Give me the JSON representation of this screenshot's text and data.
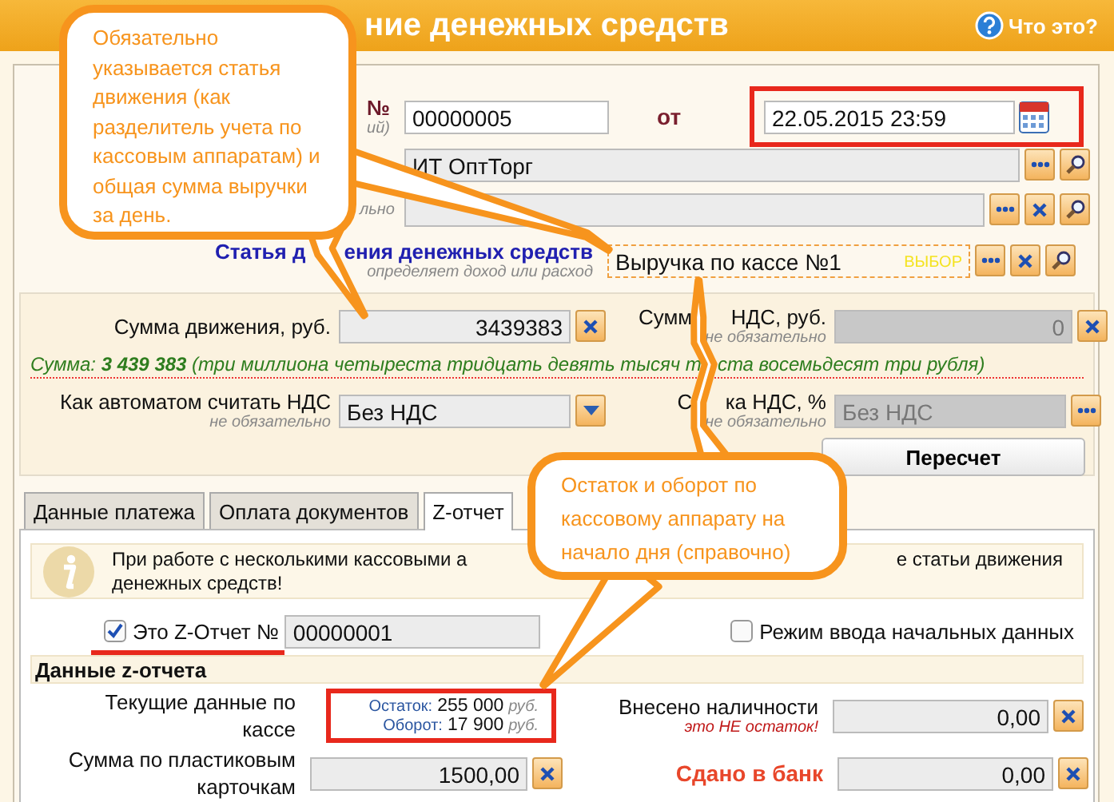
{
  "header": {
    "title": "ние денежных средств",
    "help_link": "Что это?"
  },
  "document": {
    "number_label": "№",
    "number_hint": "ий)",
    "number": "00000005",
    "date_label": "от",
    "date": "22.05.2015 23:59",
    "date_highlighted": true
  },
  "organization": {
    "value": "ИТ ОптТорг"
  },
  "row_3": {
    "hint": "льно"
  },
  "cash_flow_item": {
    "label_parts": [
      "Статья д",
      "ения денежных средств"
    ],
    "hint": "определяет доход или расход",
    "value": "Выручка по кассе №1",
    "choose_label": "ВЫБОР"
  },
  "amounts": {
    "amount_label": "Сумма движения, руб.",
    "amount": "3439383",
    "vat_label_parts": [
      "Сумм",
      "НДС, руб."
    ],
    "vat_hint": "не обязательно",
    "vat": "0",
    "amount_text_parts": [
      "Сумма: **3 439 383** (три миллиона четыреста тридцать девять тысяч т",
      "ста восемьдесят три рубля)"
    ],
    "vat_mode_label": "Как автоматом считать НДС",
    "vat_mode_hint": "не обязательно",
    "vat_mode": "Без НДС",
    "vat_rate_label_parts": [
      "С",
      "ка НДС, %"
    ],
    "vat_rate_hint": "не обязательно",
    "vat_rate": "Без НДС",
    "recalc_button": "Пересчет"
  },
  "tabs": [
    {
      "label": "Данные платежа",
      "selected": false
    },
    {
      "label": "Оплата документов",
      "selected": false
    },
    {
      "label": "Z-отчет",
      "selected": true
    }
  ],
  "z_report": {
    "info_parts": [
      "При работе с несколькими кассовыми а",
      "е статьи движения"
    ],
    "info_line_2": "денежных средств!",
    "is_z_report": {
      "label": "Это Z-Отчет №",
      "checked": true,
      "number": "00000001",
      "underlined": true
    },
    "initial_mode": {
      "label": "Режим ввода начальных данных",
      "checked": false
    },
    "section_title": "Данные z-отчета",
    "current_data": {
      "label": "Текущие данные по кассе",
      "balance_label": "Остаток:",
      "balance": "255 000",
      "balance_unit": "руб.",
      "turnover_label": "Оборот:",
      "turnover": "17 900",
      "turnover_unit": "руб.",
      "highlighted": true
    },
    "cash_deposited": {
      "label": "Внесено наличности",
      "hint": "это НЕ остаток!",
      "value": "0,00"
    },
    "card_sum": {
      "label": "Сумма по пластиковым карточкам",
      "value": "1500,00"
    },
    "bank": {
      "label": "Сдано в банк",
      "value": "0,00"
    }
  },
  "callouts": [
    {
      "text": "Обязательно указывается статья движения (как разделитель учета по кассовым аппаратам) и общая сумма выручки за день."
    },
    {
      "text": "Остаток и оборот по кассовому аппарату на начало дня (справочно)"
    }
  ]
}
